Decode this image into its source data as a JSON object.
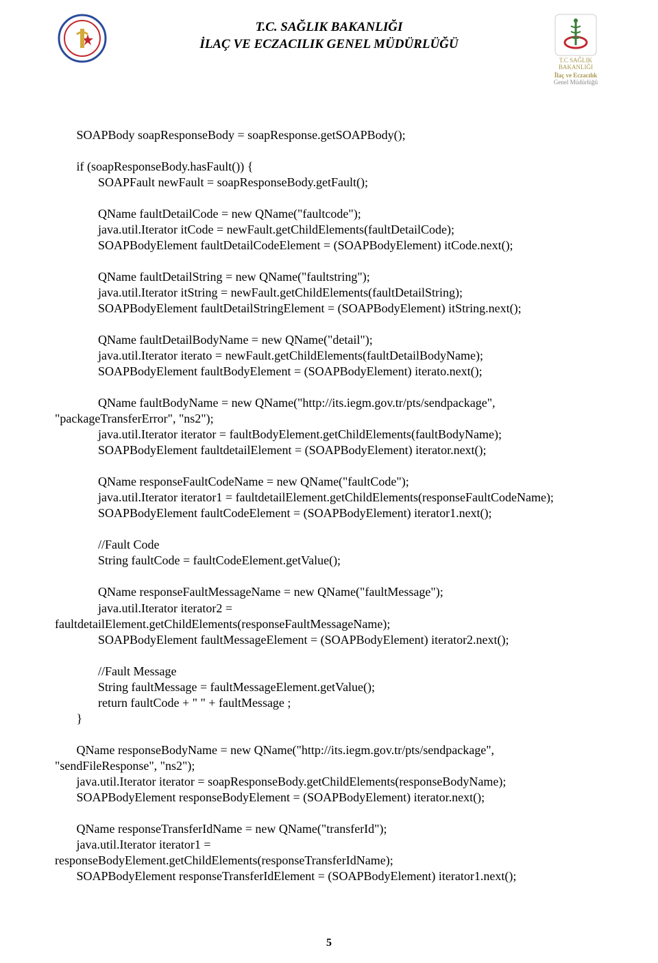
{
  "header": {
    "title_line1": "T.C. SAĞLIK BAKANLIĞI",
    "title_line2": "İLAÇ VE ECZACILIK GENEL MÜDÜRLÜĞÜ",
    "right_logo_line1": "T.C SAĞLIK BAKANLIĞI",
    "right_logo_line2": "İlaç ve Eczacılık",
    "right_logo_line3": "Genel Müdürlüğü"
  },
  "code": "       SOAPBody soapResponseBody = soapResponse.getSOAPBody();\n\n       if (soapResponseBody.hasFault()) {\n              SOAPFault newFault = soapResponseBody.getFault();\n\n              QName faultDetailCode = new QName(\"faultcode\");\n              java.util.Iterator itCode = newFault.getChildElements(faultDetailCode);\n              SOAPBodyElement faultDetailCodeElement = (SOAPBodyElement) itCode.next();\n\n              QName faultDetailString = new QName(\"faultstring\");\n              java.util.Iterator itString = newFault.getChildElements(faultDetailString);\n              SOAPBodyElement faultDetailStringElement = (SOAPBodyElement) itString.next();\n\n              QName faultDetailBodyName = new QName(\"detail\");\n              java.util.Iterator iterato = newFault.getChildElements(faultDetailBodyName);\n              SOAPBodyElement faultBodyElement = (SOAPBodyElement) iterato.next();\n\n              QName faultBodyName = new QName(\"http://its.iegm.gov.tr/pts/sendpackage\",\n\"packageTransferError\", \"ns2\");\n              java.util.Iterator iterator = faultBodyElement.getChildElements(faultBodyName);\n              SOAPBodyElement faultdetailElement = (SOAPBodyElement) iterator.next();\n\n              QName responseFaultCodeName = new QName(\"faultCode\");\n              java.util.Iterator iterator1 = faultdetailElement.getChildElements(responseFaultCodeName);\n              SOAPBodyElement faultCodeElement = (SOAPBodyElement) iterator1.next();\n\n              //Fault Code\n              String faultCode = faultCodeElement.getValue();\n\n              QName responseFaultMessageName = new QName(\"faultMessage\");\n              java.util.Iterator iterator2 =\nfaultdetailElement.getChildElements(responseFaultMessageName);\n              SOAPBodyElement faultMessageElement = (SOAPBodyElement) iterator2.next();\n\n              //Fault Message\n              String faultMessage = faultMessageElement.getValue();\n              return faultCode + \" \" + faultMessage ;\n       }\n\n       QName responseBodyName = new QName(\"http://its.iegm.gov.tr/pts/sendpackage\",\n\"sendFileResponse\", \"ns2\");\n       java.util.Iterator iterator = soapResponseBody.getChildElements(responseBodyName);\n       SOAPBodyElement responseBodyElement = (SOAPBodyElement) iterator.next();\n\n       QName responseTransferIdName = new QName(\"transferId\");\n       java.util.Iterator iterator1 =\nresponseBodyElement.getChildElements(responseTransferIdName);\n       SOAPBodyElement responseTransferIdElement = (SOAPBodyElement) iterator1.next();",
  "page_number": "5"
}
